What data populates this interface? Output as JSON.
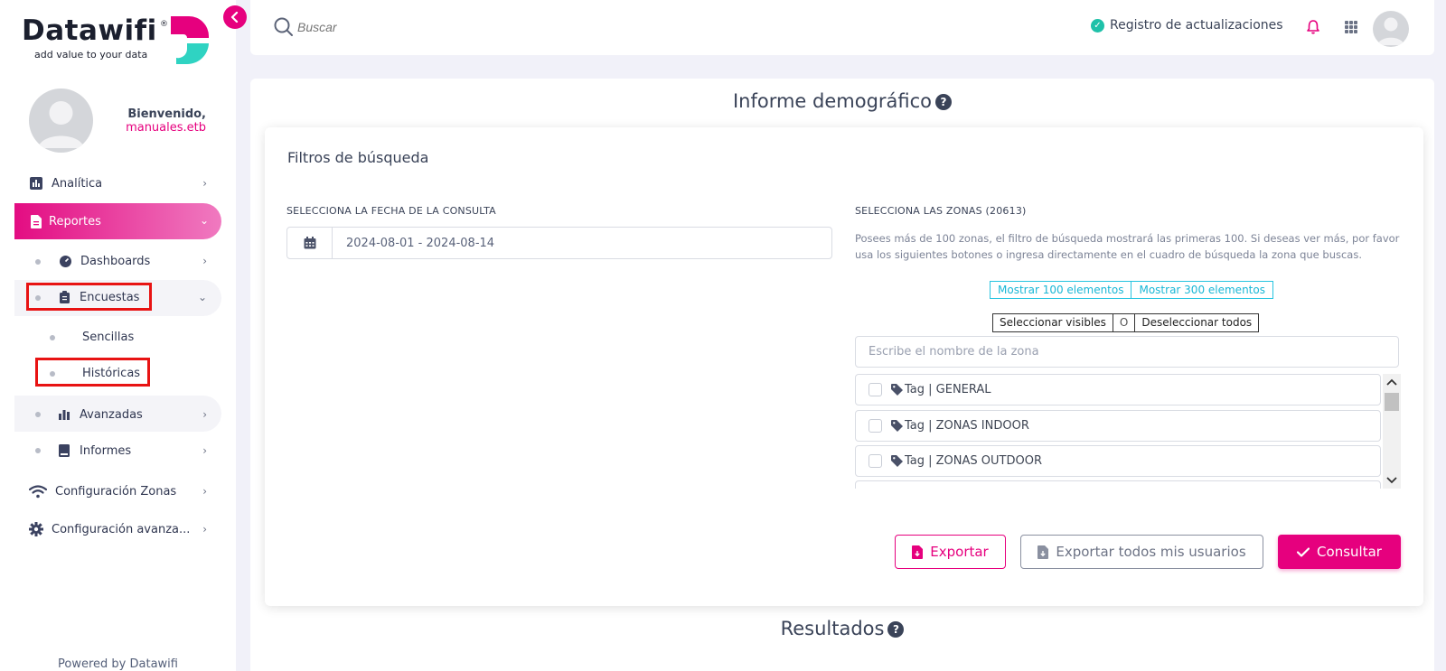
{
  "brand": {
    "name": "Datawifi",
    "registered": "®",
    "tagline": "add value to your data",
    "accent_color": "#e6007e",
    "teal_color": "#2fd3c2"
  },
  "profile": {
    "greeting": "Bienvenido,",
    "username": "manuales.etb"
  },
  "sidebar": {
    "items": [
      {
        "label": "Analítica",
        "icon": "bar-chart-icon"
      },
      {
        "label": "Reportes",
        "icon": "document-icon",
        "active": true
      },
      {
        "label": "Dashboards",
        "icon": "gauge-icon"
      },
      {
        "label": "Encuestas",
        "icon": "clipboard-icon"
      },
      {
        "label": "Sencillas"
      },
      {
        "label": "Históricas"
      },
      {
        "label": "Avanzadas",
        "icon": "bar-chart-icon"
      },
      {
        "label": "Informes",
        "icon": "book-icon"
      },
      {
        "label": "Configuración Zonas",
        "icon": "wifi-icon"
      },
      {
        "label": "Configuración avanza...",
        "icon": "gear-icon"
      }
    ],
    "footer": "Powered by Datawifi"
  },
  "topbar": {
    "search_placeholder": "Buscar",
    "updates_label": "Registro de actualizaciones"
  },
  "page": {
    "title": "Informe demográfico",
    "filters_title": "Filtros de búsqueda",
    "date_label": "SELECCIONA LA FECHA DE LA CONSULTA",
    "date_value": "2024-08-01 - 2024-08-14",
    "zones_label": "SELECCIONA LAS ZONAS (20613)",
    "zones_note": "Posees más de 100 zonas, el filtro de búsqueda mostrará las primeras 100. Si deseas ver más, por favor usa los siguientes botones o ingresa directamente en el cuadro de búsqueda la zona que buscas.",
    "show_100": "Mostrar 100 elementos",
    "show_300": "Mostrar 300 elementos",
    "select_visible": "Seleccionar visibles",
    "or_label": "O",
    "deselect_all": "Deseleccionar todos",
    "zone_search_placeholder": "Escribe el nombre de la zona",
    "zones": [
      {
        "label": "Tag | GENERAL",
        "checked": false
      },
      {
        "label": "Tag | ZONAS INDOOR",
        "checked": false
      },
      {
        "label": "Tag | ZONAS OUTDOOR",
        "checked": false
      }
    ],
    "export_label": "Exportar",
    "export_all_label": "Exportar todos mis usuarios",
    "submit_label": "Consultar",
    "results_title": "Resultados"
  }
}
